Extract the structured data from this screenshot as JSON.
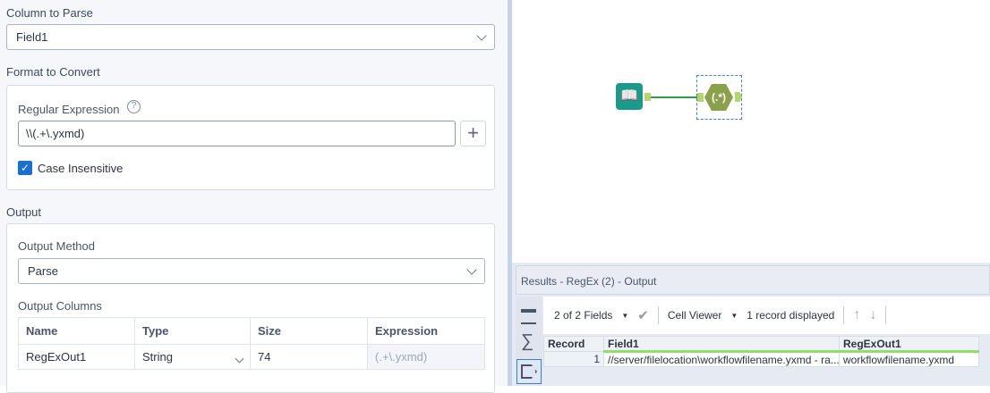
{
  "config": {
    "column_to_parse": {
      "label": "Column to Parse",
      "value": "Field1"
    },
    "format": {
      "label": "Format to Convert",
      "regex_label": "Regular Expression",
      "regex_value": "\\\\(.+\\.yxmd)",
      "add_button": "+",
      "case_insensitive_label": "Case Insensitive",
      "case_insensitive": true
    },
    "output": {
      "label": "Output",
      "method_label": "Output Method",
      "method_value": "Parse",
      "columns_label": "Output Columns",
      "headers": [
        "Name",
        "Type",
        "Size",
        "Expression"
      ],
      "rows": [
        {
          "name": "RegExOut1",
          "type": "String",
          "size": "74",
          "expression": "(.+\\.yxmd)"
        }
      ]
    }
  },
  "canvas": {
    "tool_icon_text": "(.*)"
  },
  "results": {
    "title": "Results - RegEx (2) - Output",
    "fields": "2 of 2 Fields",
    "viewer": "Cell Viewer",
    "records": "1 record displayed",
    "headers": [
      "Record",
      "Field1",
      "RegExOut1"
    ],
    "rows": [
      {
        "record": "1",
        "field1": "//server/filelocation\\workflowfilename.yxmd - ra...",
        "out": "workflowfilename.yxmd"
      }
    ]
  },
  "colors": {
    "accent": "#1a6fd1",
    "tool_green": "#8aa04a",
    "input_teal": "#1a9a8a"
  }
}
